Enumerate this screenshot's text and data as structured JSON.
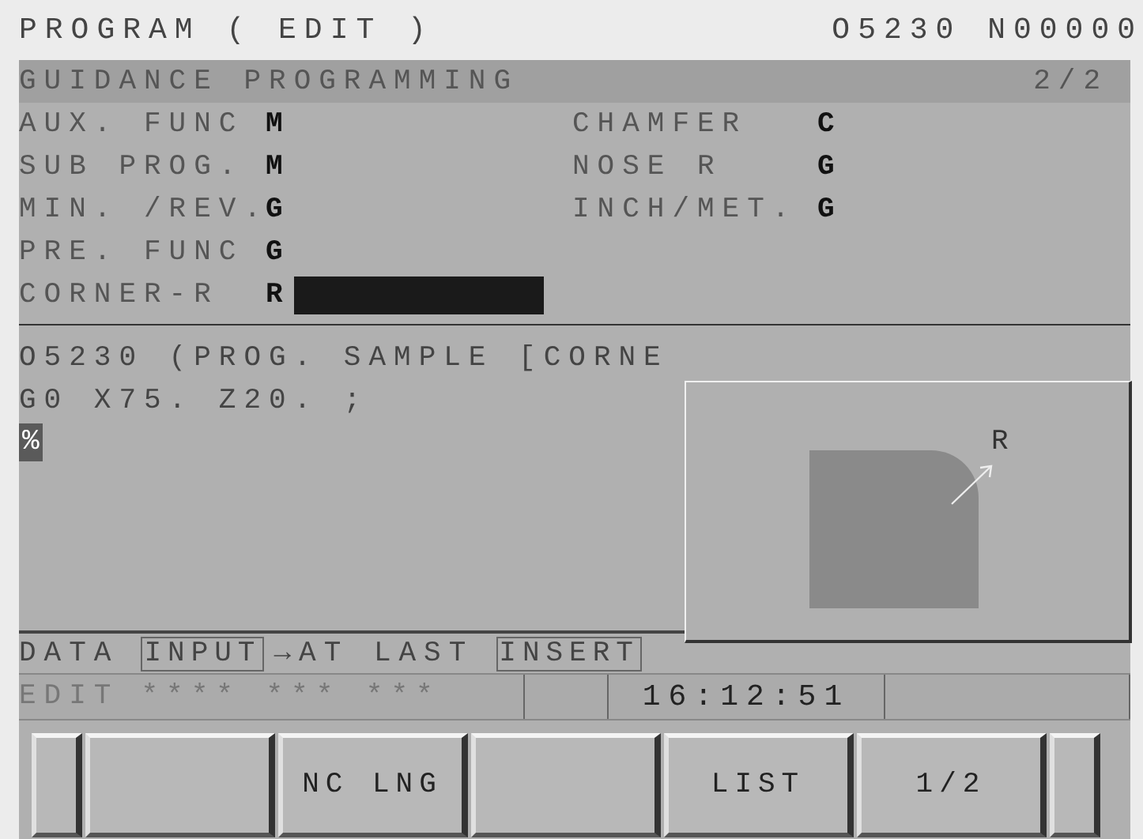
{
  "header": {
    "title": "PROGRAM ( EDIT )",
    "program_info": "O5230 N00000"
  },
  "guidance": {
    "title": "GUIDANCE PROGRAMMING",
    "page": "2/2"
  },
  "fields": [
    {
      "label": "AUX. FUNC",
      "value": "M"
    },
    {
      "label": "CHAMFER",
      "value": "C"
    },
    {
      "label": "SUB PROG.",
      "value": "M"
    },
    {
      "label": "NOSE R",
      "value": "G"
    },
    {
      "label": "MIN. /REV.",
      "value": "G"
    },
    {
      "label": "INCH/MET.",
      "value": "G"
    },
    {
      "label": "PRE. FUNC",
      "value": "G"
    }
  ],
  "input_field": {
    "label": "CORNER-R",
    "prefix": "R"
  },
  "program_lines": [
    "O5230 (PROG. SAMPLE [CORNE",
    "G0 X75. Z20. ;"
  ],
  "cursor": "%",
  "figure": {
    "label": "R"
  },
  "data_line": [
    {
      "kind": "plain",
      "text": "DATA"
    },
    {
      "kind": "boxed",
      "text": "INPUT"
    },
    {
      "kind": "plain",
      "text": "→AT LAST"
    },
    {
      "kind": "boxed",
      "text": "INSERT"
    }
  ],
  "status_bar": {
    "mode": "EDIT",
    "flags": "**** *** ***",
    "time": "16:12:51"
  },
  "softkeys": [
    {
      "kind": "edge"
    },
    {
      "kind": "key"
    },
    {
      "kind": "key",
      "label": "NC LNG"
    },
    {
      "kind": "key"
    },
    {
      "kind": "key",
      "label": "LIST"
    },
    {
      "kind": "key",
      "label": "1/2"
    },
    {
      "kind": "edge"
    }
  ]
}
